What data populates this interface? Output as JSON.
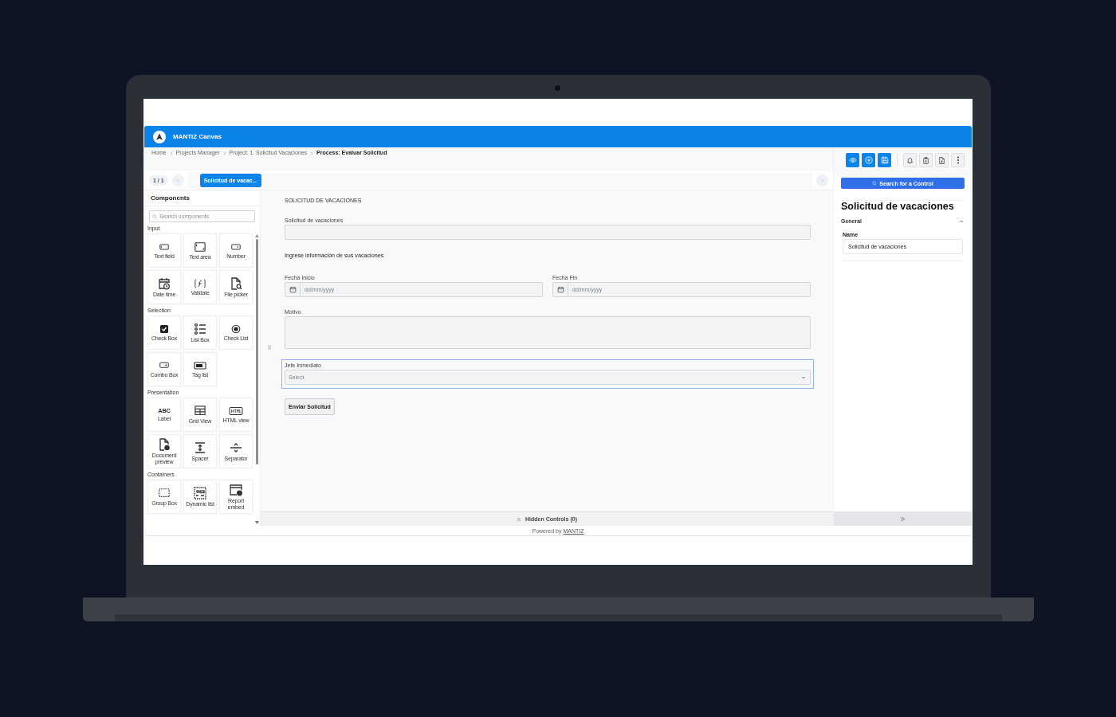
{
  "app": {
    "title": "MANTIZ Canvas"
  },
  "breadcrumb": [
    {
      "label": "Home",
      "current": false
    },
    {
      "label": "Projects Manager",
      "current": false
    },
    {
      "label": "Project: 1. Solicitud Vacaciones",
      "current": false
    },
    {
      "label": "Process: Evaluar Solicitud",
      "current": true
    }
  ],
  "toolbar": [
    {
      "kind": "eye",
      "primary": true
    },
    {
      "kind": "plus",
      "primary": true
    },
    {
      "kind": "save",
      "primary": true
    },
    {
      "kind": "bell",
      "primary": false
    },
    {
      "kind": "clipboard",
      "primary": false
    },
    {
      "kind": "file",
      "primary": false
    },
    {
      "kind": "more",
      "primary": false
    }
  ],
  "pager": {
    "count": "1 / 1"
  },
  "tabs": [
    {
      "label": "Solicitud de vacac...",
      "selected": true
    }
  ],
  "components": {
    "title": "Components",
    "search_placeholder": "Search components",
    "groups": [
      {
        "label": "Input",
        "items": [
          {
            "label": "Text field",
            "kind": "textfield"
          },
          {
            "label": "Text area",
            "kind": "textarea"
          },
          {
            "label": "Number",
            "kind": "number"
          },
          {
            "label": "Date time",
            "kind": "datetime"
          },
          {
            "label": "Validate",
            "kind": "function"
          },
          {
            "label": "File picker",
            "kind": "filepicker"
          }
        ]
      },
      {
        "label": "Selection",
        "items": [
          {
            "label": "Check Box",
            "kind": "checkbox"
          },
          {
            "label": "List Box",
            "kind": "listbox"
          },
          {
            "label": "Check List",
            "kind": "radio"
          },
          {
            "label": "Combo Box",
            "kind": "combo"
          },
          {
            "label": "Tag list",
            "kind": "tag"
          }
        ]
      },
      {
        "label": "Presentation",
        "items": [
          {
            "label": "ABC",
            "caption": "Label",
            "kind": "text"
          },
          {
            "label": "Grid View",
            "kind": "grid"
          },
          {
            "label": "HTML view",
            "kind": "html"
          },
          {
            "label": "Document preview",
            "kind": "docpreview"
          },
          {
            "label": "Spacer",
            "kind": "spacer"
          },
          {
            "label": "Separator",
            "kind": "separator"
          }
        ]
      },
      {
        "label": "Containers",
        "items": [
          {
            "label": "Group Box",
            "kind": "groupbox"
          },
          {
            "label": "Dynamic list",
            "kind": "dynlist"
          },
          {
            "label": "Report embed",
            "kind": "report"
          }
        ]
      }
    ]
  },
  "form": {
    "title": "SOLICITUD DE VACACIONES",
    "fields": [
      {
        "kind": "text",
        "label": "Solicitud de vacaciones",
        "selected": false
      },
      {
        "kind": "heading",
        "label": "Ingrese información de sus vacaciones"
      },
      {
        "kind": "dates",
        "items": [
          {
            "label": "Fecha Inicio",
            "placeholder": "dd/mm/yyyy"
          },
          {
            "label": "Fecha Fin",
            "placeholder": "dd/mm/yyyy"
          }
        ]
      },
      {
        "kind": "textarea",
        "label": "Motivo",
        "selected": false
      },
      {
        "kind": "select",
        "label": "Jefe Inmediato",
        "placeholder": "Select",
        "selected": true
      },
      {
        "kind": "button",
        "label": "Enviar Solicitud"
      }
    ]
  },
  "hidden_controls": {
    "label": "Hidden Controls (0)"
  },
  "properties": {
    "search_button": "Search for a Control",
    "title": "Solicitud de vacaciones",
    "section": {
      "label": "General",
      "expanded": true
    },
    "name_label": "Name",
    "name_value": "Solicitud de vacaciones"
  },
  "footer": {
    "text": "Powered by",
    "link": "MANTIZ"
  }
}
